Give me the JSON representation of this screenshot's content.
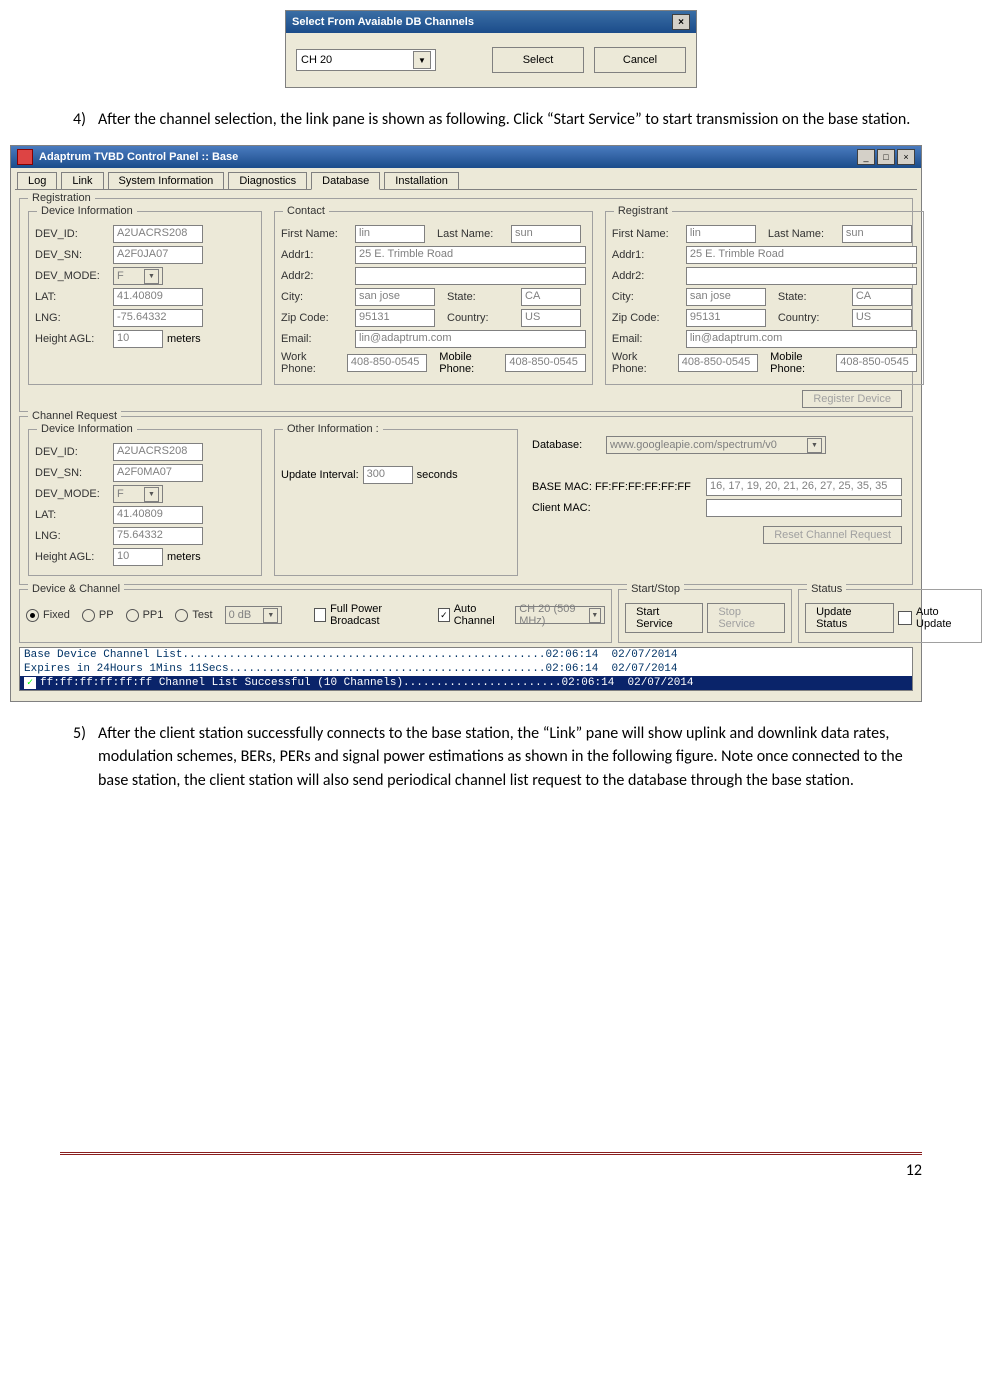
{
  "dialog": {
    "title": "Select From Avaiable DB Channels",
    "selected": "CH 20",
    "select_btn": "Select",
    "cancel_btn": "Cancel"
  },
  "step4": {
    "num": "4)",
    "text": "After the channel selection, the link pane is shown as following. Click “Start Service” to start transmission on the base station."
  },
  "app": {
    "title": "Adaptrum TVBD Control Panel :: Base",
    "tabs": [
      "Log",
      "Link",
      "System Information",
      "Diagnostics",
      "Database",
      "Installation"
    ],
    "active_tab": "Database",
    "registration_label": "Registration",
    "device_info_label": "Device Information",
    "contact_label": "Contact",
    "registrant_label": "Registrant",
    "channel_request_label": "Channel Request",
    "other_info_label": "Other Information :",
    "device_channel_label": "Device & Channel",
    "start_stop_label": "Start/Stop",
    "status_label": "Status",
    "dev": {
      "dev_id_lbl": "DEV_ID:",
      "dev_id": "A2UACRS208",
      "dev_sn_lbl": "DEV_SN:",
      "dev_sn": "A2F0JA07",
      "dev_mode_lbl": "DEV_MODE:",
      "dev_mode": "F",
      "lat_lbl": "LAT:",
      "lat": "41.40809",
      "lng_lbl": "LNG:",
      "lng": "-75.64332",
      "hagl_lbl": "Height AGL:",
      "hagl": "10",
      "hagl_unit": "meters"
    },
    "contact": {
      "first_lbl": "First Name:",
      "first": "lin",
      "last_lbl": "Last Name:",
      "last": "sun",
      "addr1_lbl": "Addr1:",
      "addr1": "25 E. Trimble Road",
      "addr2_lbl": "Addr2:",
      "addr2": "",
      "city_lbl": "City:",
      "city": "san jose",
      "state_lbl": "State:",
      "state": "CA",
      "zip_lbl": "Zip Code:",
      "zip": "95131",
      "country_lbl": "Country:",
      "country": "US",
      "email_lbl": "Email:",
      "email": "lin@adaptrum.com",
      "wphone_lbl": "Work Phone:",
      "wphone": "408-850-0545",
      "mphone_lbl": "Mobile Phone:",
      "mphone": "408-850-0545"
    },
    "reg_device_btn": "Register Device",
    "cr_dev": {
      "dev_id": "A2UACRS208",
      "dev_sn": "A2F0MA07",
      "dev_mode": "F",
      "lat": "41.40809",
      "lng": "75.64332",
      "hagl": "10"
    },
    "other": {
      "update_lbl": "Update Interval:",
      "update_val": "300",
      "update_unit": "seconds"
    },
    "db": {
      "database_lbl": "Database:",
      "database_val": "www.googleapie.com/spectrum/v0",
      "base_mac_lbl": "BASE MAC: FF:FF:FF:FF:FF:FF",
      "base_mac_val": "16, 17, 19, 20, 21, 26, 27, 25, 35, 35",
      "client_mac_lbl": "Client MAC:"
    },
    "reset_btn": "Reset Channel Request",
    "radios": {
      "fixed": "Fixed",
      "pp": "PP",
      "pp1": "PP1",
      "test": "Test"
    },
    "gain_sel": "0 dB",
    "full_power": "Full Power Broadcast",
    "auto_channel": "Auto Channel",
    "channel_sel": "CH 20 (509 MHz)",
    "start_btn": "Start Service",
    "stop_btn": "Stop Service",
    "update_btn": "Update Status",
    "auto_update": "Auto Update",
    "log": [
      "Base Device Channel List.......................................................02:06:14  02/07/2014",
      "Expires in 24Hours 1Mins 11Secs................................................02:06:14  02/07/2014",
      "ff:ff:ff:ff:ff:ff Channel List Successful (10 Channels)........................02:06:14  02/07/2014"
    ]
  },
  "step5": {
    "num": "5)",
    "text": "After the client station successfully connects to the base station, the “Link” pane will show uplink and downlink data rates, modulation schemes, BERs, PERs and signal power estimations as shown in the following figure. Note once connected to the base station, the client station will also send periodical channel list request to the database through the base station."
  },
  "page_number": "12"
}
